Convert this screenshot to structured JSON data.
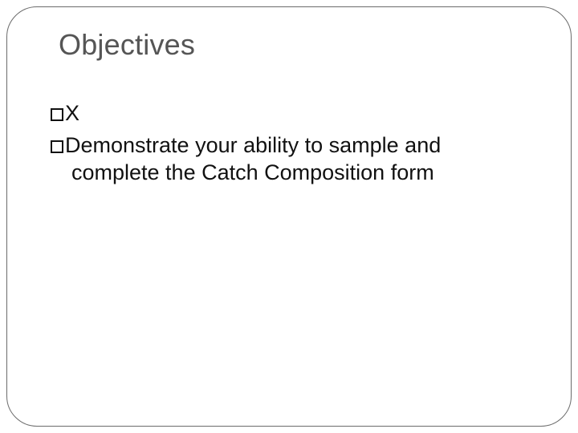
{
  "slide": {
    "title": "Objectives",
    "bullets": [
      {
        "text": "X"
      },
      {
        "text": "Demonstrate your ability to sample and",
        "cont": "complete the Catch Composition form"
      }
    ]
  }
}
